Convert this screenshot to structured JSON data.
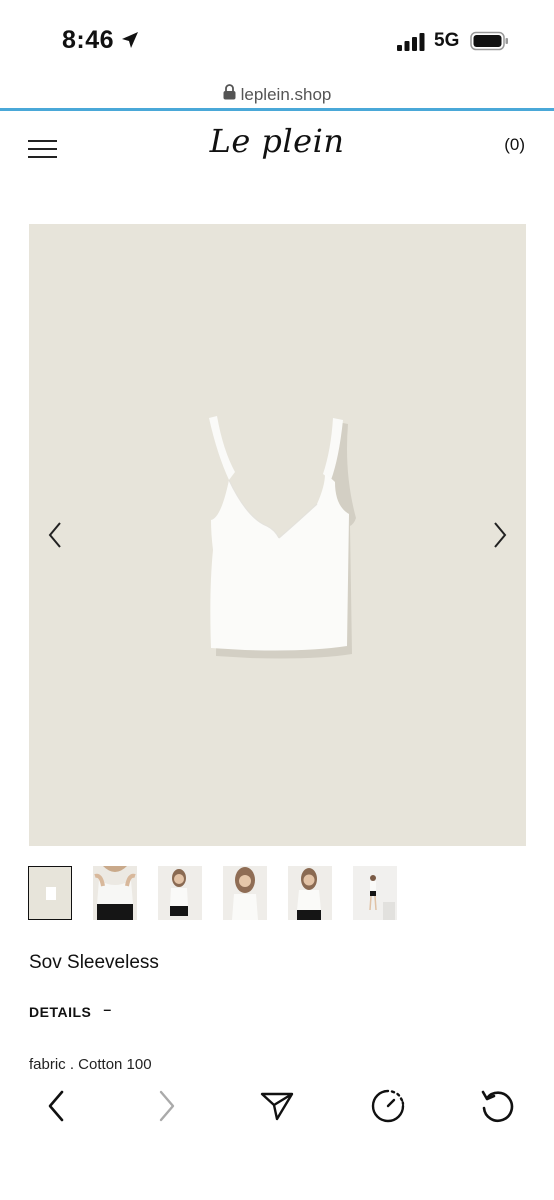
{
  "status_bar": {
    "time": "8:46",
    "network": "5G",
    "icons": [
      "location-arrow-icon",
      "signal-bars-icon",
      "battery-icon"
    ]
  },
  "browser": {
    "url": "leplein.shop",
    "lock_icon": "lock-icon",
    "accent_color": "#4aa8d8"
  },
  "header": {
    "menu_icon": "hamburger-menu-icon",
    "logo_text": "Le plein",
    "cart_label": "(0)"
  },
  "gallery": {
    "background_color": "#e7e4da",
    "prev_icon": "chevron-left-icon",
    "next_icon": "chevron-right-icon",
    "active_index": 0,
    "thumbnail_count": 6
  },
  "product": {
    "title": "Sov Sleeveless",
    "details_label": "DETAILS",
    "details_toggle": "–",
    "fabric": "fabric . Cotton 100"
  },
  "toolbar": {
    "buttons": [
      "back-icon",
      "forward-icon",
      "send-icon",
      "timer-icon",
      "refresh-icon"
    ]
  }
}
